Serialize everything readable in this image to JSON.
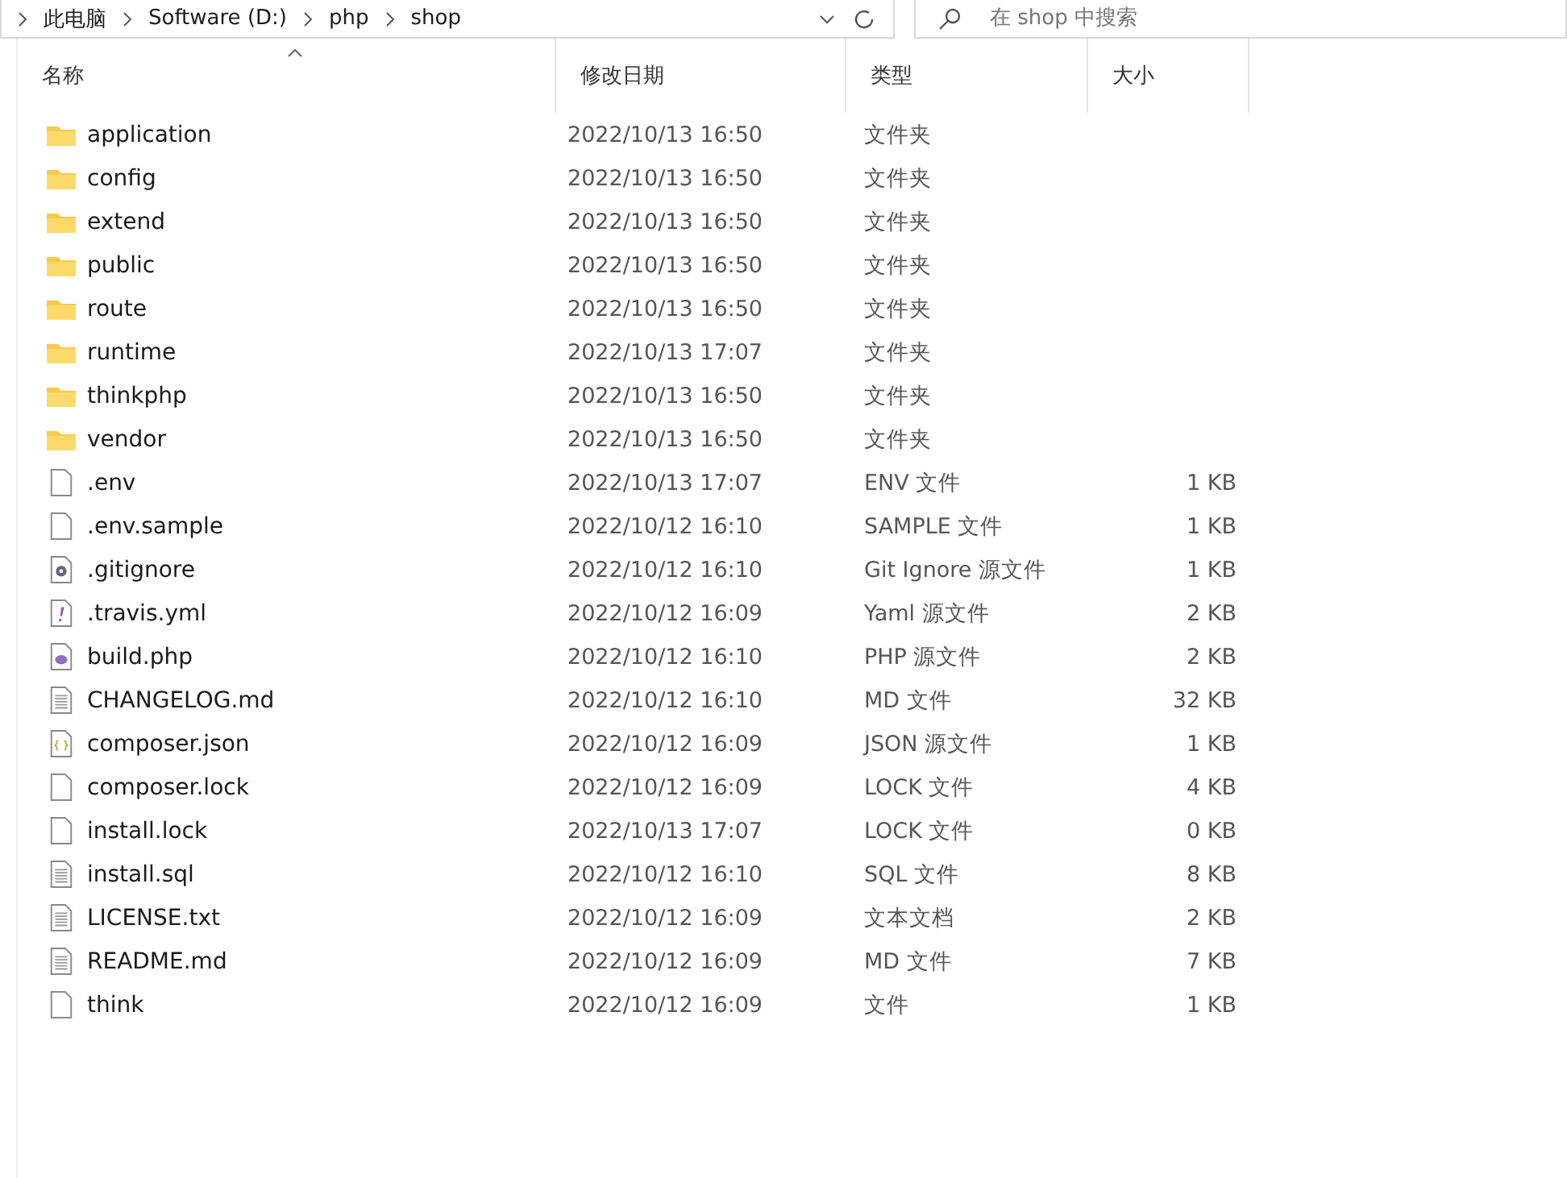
{
  "address_bar": {
    "crumbs": [
      "此电脑",
      "Software (D:)",
      "php",
      "shop"
    ]
  },
  "search": {
    "placeholder": "在 shop 中搜索"
  },
  "columns": [
    {
      "label": "名称",
      "sorted": true
    },
    {
      "label": "修改日期",
      "sorted": false
    },
    {
      "label": "类型",
      "sorted": false
    },
    {
      "label": "大小",
      "sorted": false
    }
  ],
  "rows": [
    {
      "kind": "folder",
      "name": "application",
      "date": "2022/10/13 16:50",
      "type": "文件夹"
    },
    {
      "kind": "folder",
      "name": "config",
      "date": "2022/10/13 16:50",
      "type": "文件夹"
    },
    {
      "kind": "folder",
      "name": "extend",
      "date": "2022/10/13 16:50",
      "type": "文件夹"
    },
    {
      "kind": "folder",
      "name": "public",
      "date": "2022/10/13 16:50",
      "type": "文件夹"
    },
    {
      "kind": "folder",
      "name": "route",
      "date": "2022/10/13 16:50",
      "type": "文件夹"
    },
    {
      "kind": "folder",
      "name": "runtime",
      "date": "2022/10/13 17:07",
      "type": "文件夹"
    },
    {
      "kind": "folder",
      "name": "thinkphp",
      "date": "2022/10/13 16:50",
      "type": "文件夹"
    },
    {
      "kind": "folder",
      "name": "vendor",
      "date": "2022/10/13 16:50",
      "type": "文件夹"
    },
    {
      "kind": "blank",
      "name": ".env",
      "date": "2022/10/13 17:07",
      "type": "ENV 文件",
      "size": "1 KB"
    },
    {
      "kind": "blank",
      "name": ".env.sample",
      "date": "2022/10/12 16:10",
      "type": "SAMPLE 文件",
      "size": "1 KB"
    },
    {
      "kind": "gear",
      "name": ".gitignore",
      "date": "2022/10/12 16:10",
      "type": "Git Ignore 源文件",
      "size": "1 KB"
    },
    {
      "kind": "yaml",
      "name": ".travis.yml",
      "date": "2022/10/12 16:09",
      "type": "Yaml 源文件",
      "size": "2 KB"
    },
    {
      "kind": "php",
      "name": "build.php",
      "date": "2022/10/12 16:10",
      "type": "PHP 源文件",
      "size": "2 KB"
    },
    {
      "kind": "text",
      "name": "CHANGELOG.md",
      "date": "2022/10/12 16:10",
      "type": "MD 文件",
      "size": "32 KB"
    },
    {
      "kind": "json",
      "name": "composer.json",
      "date": "2022/10/12 16:09",
      "type": "JSON 源文件",
      "size": "1 KB"
    },
    {
      "kind": "blank",
      "name": "composer.lock",
      "date": "2022/10/12 16:09",
      "type": "LOCK 文件",
      "size": "4 KB"
    },
    {
      "kind": "blank",
      "name": "install.lock",
      "date": "2022/10/13 17:07",
      "type": "LOCK 文件",
      "size": "0 KB"
    },
    {
      "kind": "text",
      "name": "install.sql",
      "date": "2022/10/12 16:10",
      "type": "SQL 文件",
      "size": "8 KB"
    },
    {
      "kind": "text",
      "name": "LICENSE.txt",
      "date": "2022/10/12 16:09",
      "type": "文本文档",
      "size": "2 KB"
    },
    {
      "kind": "text",
      "name": "README.md",
      "date": "2022/10/12 16:09",
      "type": "MD 文件",
      "size": "7 KB"
    },
    {
      "kind": "blank",
      "name": "think",
      "date": "2022/10/12 16:09",
      "type": "文件",
      "size": "1 KB"
    }
  ]
}
